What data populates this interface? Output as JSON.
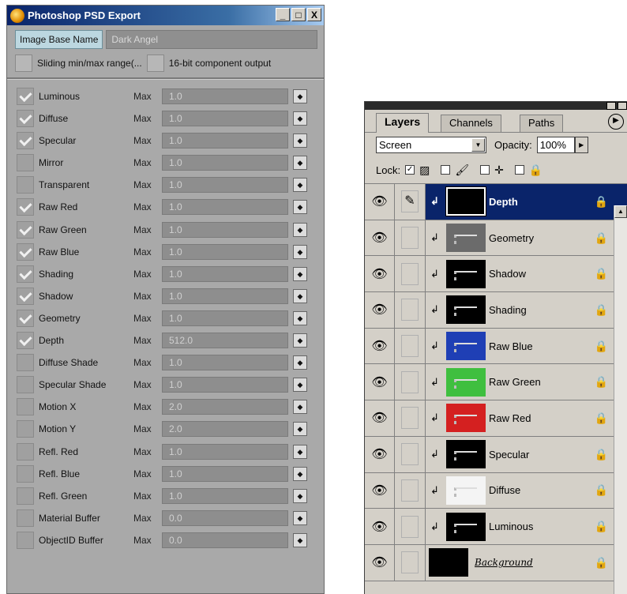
{
  "export_window": {
    "title": "Photoshop PSD Export",
    "controls": [
      "_",
      "□",
      "X"
    ],
    "image_base_name_label": "Image Base Name",
    "image_base_name_value": "Dark Angel",
    "sliding_label": "Sliding min/max range(...",
    "bit16_label": "16-bit component output",
    "max_label": "Max",
    "spinner_glyph": "◆",
    "buffers": [
      {
        "label": "Luminous",
        "checked": true,
        "value": "1.0"
      },
      {
        "label": "Diffuse",
        "checked": true,
        "value": "1.0"
      },
      {
        "label": "Specular",
        "checked": true,
        "value": "1.0"
      },
      {
        "label": "Mirror",
        "checked": false,
        "value": "1.0"
      },
      {
        "label": "Transparent",
        "checked": false,
        "value": "1.0"
      },
      {
        "label": "Raw Red",
        "checked": true,
        "value": "1.0"
      },
      {
        "label": "Raw Green",
        "checked": true,
        "value": "1.0"
      },
      {
        "label": "Raw Blue",
        "checked": true,
        "value": "1.0"
      },
      {
        "label": "Shading",
        "checked": true,
        "value": "1.0"
      },
      {
        "label": "Shadow",
        "checked": true,
        "value": "1.0"
      },
      {
        "label": "Geometry",
        "checked": true,
        "value": "1.0"
      },
      {
        "label": "Depth",
        "checked": true,
        "value": "512.0"
      },
      {
        "label": "Diffuse Shade",
        "checked": false,
        "value": "1.0"
      },
      {
        "label": "Specular Shade",
        "checked": false,
        "value": "1.0"
      },
      {
        "label": "Motion X",
        "checked": false,
        "value": "2.0"
      },
      {
        "label": "Motion Y",
        "checked": false,
        "value": "2.0"
      },
      {
        "label": "Refl. Red",
        "checked": false,
        "value": "1.0"
      },
      {
        "label": "Refl. Blue",
        "checked": false,
        "value": "1.0"
      },
      {
        "label": "Refl. Green",
        "checked": false,
        "value": "1.0"
      },
      {
        "label": "Material Buffer",
        "checked": false,
        "value": "0.0"
      },
      {
        "label": "ObjectID Buffer",
        "checked": false,
        "value": "0.0"
      }
    ]
  },
  "layers_palette": {
    "tabs": [
      "Layers",
      "Channels",
      "Paths"
    ],
    "blend_mode": "Screen",
    "opacity_label": "Opacity:",
    "opacity_value": "100%",
    "lock_label": "Lock:",
    "layers": [
      {
        "name": "Depth",
        "selected": true,
        "thumb_color": "#000000",
        "clipped": true
      },
      {
        "name": "Geometry",
        "selected": false,
        "thumb_color": "#6b6b6b",
        "clipped": true
      },
      {
        "name": "Shadow",
        "selected": false,
        "thumb_color": "#000000",
        "clipped": true
      },
      {
        "name": "Shading",
        "selected": false,
        "thumb_color": "#000000",
        "clipped": true
      },
      {
        "name": "Raw Blue",
        "selected": false,
        "thumb_color": "#1f3fb5",
        "clipped": true
      },
      {
        "name": "Raw Green",
        "selected": false,
        "thumb_color": "#3fbf3f",
        "clipped": true
      },
      {
        "name": "Raw Red",
        "selected": false,
        "thumb_color": "#d42020",
        "clipped": true
      },
      {
        "name": "Specular",
        "selected": false,
        "thumb_color": "#000000",
        "clipped": true
      },
      {
        "name": "Diffuse",
        "selected": false,
        "thumb_color": "#f4f4f4",
        "clipped": true
      },
      {
        "name": "Luminous",
        "selected": false,
        "thumb_color": "#000000",
        "clipped": true
      }
    ],
    "background_layer": "Background"
  }
}
